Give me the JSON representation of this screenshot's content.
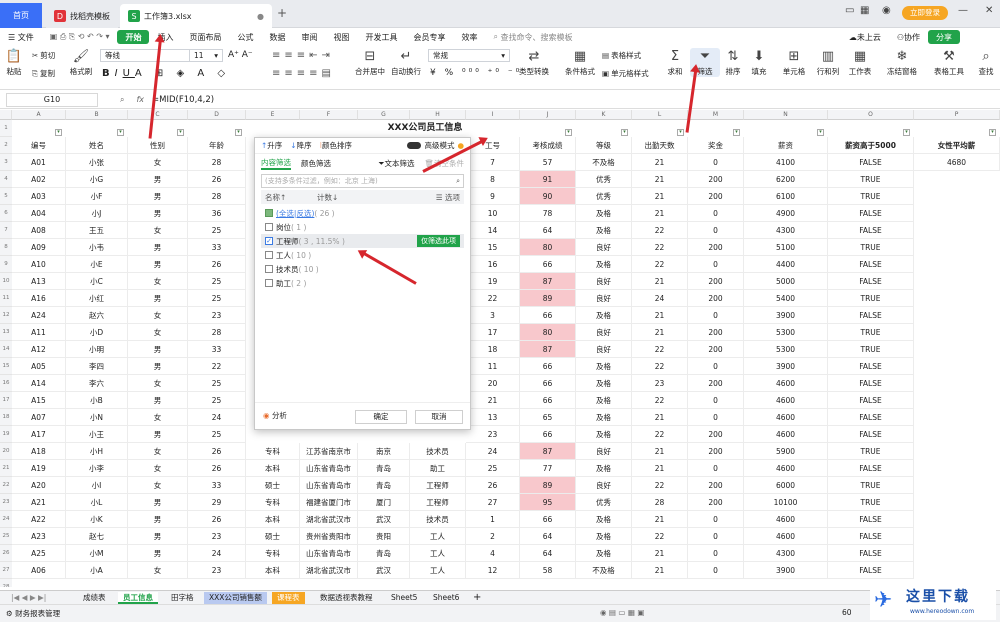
{
  "titlebar": {
    "home": "首页",
    "tab1": "找稻壳模板",
    "tab2": "工作簿3.xlsx",
    "login": "立即登录",
    "min": "—",
    "close": "✕"
  },
  "menu": {
    "file": "文件",
    "items": [
      "开始",
      "插入",
      "页面布局",
      "公式",
      "数据",
      "审阅",
      "视图",
      "开发工具",
      "会员专享",
      "效率"
    ],
    "search": "查找命令、搜索模板",
    "cloud": "未上云",
    "collab": "协作",
    "share": "分享"
  },
  "ribbon": {
    "paste": "粘贴",
    "cut": "剪切",
    "copy": "复制",
    "fmt": "格式刷",
    "font": "等线",
    "size": "11",
    "merge": "合并居中",
    "wrap": "自动换行",
    "numfmt": "常规",
    "convert": "类型转换",
    "cond": "条件格式",
    "tblstyle": "表格样式",
    "cellstyle": "单元格样式",
    "sum": "求和",
    "filter": "筛选",
    "sort": "排序",
    "fill": "填充",
    "cellg": "单元格",
    "rowcol": "行和列",
    "sheet": "工作表",
    "freeze": "冻结窗格",
    "tools": "表格工具",
    "find": "查找"
  },
  "formula": {
    "cellref": "G10",
    "fx": "fx",
    "content": "=MID(F10,4,2)"
  },
  "columns": [
    "A",
    "B",
    "C",
    "D",
    "E",
    "F",
    "G",
    "H",
    "I",
    "J",
    "K",
    "L",
    "M",
    "N",
    "O",
    "P"
  ],
  "sheet_title": "XXX公司员工信息",
  "headers": [
    "编号",
    "姓名",
    "性别",
    "年龄",
    "",
    "",
    "",
    "",
    "工号",
    "考核成绩",
    "等级",
    "出勤天数",
    "奖金",
    "薪资",
    "薪资高于5000",
    "女性平均薪"
  ],
  "avg_value": "4680",
  "rows": [
    [
      "A01",
      "小张",
      "女",
      "28",
      "",
      "",
      "",
      "",
      "7",
      "57",
      "不及格",
      "21",
      "0",
      "4100",
      "FALSE"
    ],
    [
      "A02",
      "小G",
      "男",
      "26",
      "",
      "",
      "",
      "",
      "8",
      "91",
      "优秀",
      "21",
      "200",
      "6200",
      "TRUE"
    ],
    [
      "A03",
      "小F",
      "男",
      "28",
      "",
      "",
      "",
      "",
      "9",
      "90",
      "优秀",
      "21",
      "200",
      "6100",
      "TRUE"
    ],
    [
      "A04",
      "小J",
      "男",
      "36",
      "",
      "",
      "",
      "",
      "10",
      "78",
      "及格",
      "21",
      "0",
      "4900",
      "FALSE"
    ],
    [
      "A08",
      "王五",
      "女",
      "25",
      "",
      "",
      "",
      "",
      "14",
      "64",
      "及格",
      "22",
      "0",
      "4300",
      "FALSE"
    ],
    [
      "A09",
      "小韦",
      "男",
      "33",
      "",
      "",
      "",
      "",
      "15",
      "80",
      "良好",
      "22",
      "200",
      "5100",
      "TRUE"
    ],
    [
      "A10",
      "小E",
      "男",
      "26",
      "",
      "",
      "",
      "",
      "16",
      "66",
      "及格",
      "22",
      "0",
      "4400",
      "FALSE"
    ],
    [
      "A13",
      "小C",
      "女",
      "25",
      "",
      "",
      "",
      "",
      "19",
      "87",
      "良好",
      "21",
      "200",
      "5000",
      "FALSE"
    ],
    [
      "A16",
      "小红",
      "男",
      "25",
      "",
      "",
      "",
      "",
      "22",
      "89",
      "良好",
      "24",
      "200",
      "5400",
      "TRUE"
    ],
    [
      "A24",
      "赵六",
      "女",
      "23",
      "",
      "",
      "",
      "",
      "3",
      "66",
      "及格",
      "21",
      "0",
      "3900",
      "FALSE"
    ],
    [
      "A11",
      "小D",
      "女",
      "28",
      "",
      "",
      "",
      "",
      "17",
      "80",
      "良好",
      "21",
      "200",
      "5300",
      "TRUE"
    ],
    [
      "A12",
      "小明",
      "男",
      "33",
      "",
      "",
      "",
      "",
      "18",
      "87",
      "良好",
      "22",
      "200",
      "5300",
      "TRUE"
    ],
    [
      "A05",
      "李四",
      "男",
      "22",
      "",
      "",
      "",
      "",
      "11",
      "66",
      "及格",
      "22",
      "0",
      "3900",
      "FALSE"
    ],
    [
      "A14",
      "李六",
      "女",
      "25",
      "",
      "",
      "",
      "",
      "20",
      "66",
      "及格",
      "23",
      "200",
      "4600",
      "FALSE"
    ],
    [
      "A15",
      "小B",
      "男",
      "25",
      "",
      "",
      "",
      "",
      "21",
      "66",
      "及格",
      "22",
      "0",
      "4600",
      "FALSE"
    ],
    [
      "A07",
      "小N",
      "女",
      "24",
      "",
      "",
      "",
      "",
      "13",
      "65",
      "及格",
      "21",
      "0",
      "4600",
      "FALSE"
    ],
    [
      "A17",
      "小王",
      "男",
      "25",
      "",
      "",
      "",
      "",
      "23",
      "66",
      "及格",
      "22",
      "200",
      "4600",
      "FALSE"
    ],
    [
      "A18",
      "小H",
      "女",
      "26",
      "专科",
      "江苏省南京市",
      "南京",
      "技术员",
      "24",
      "87",
      "良好",
      "21",
      "200",
      "5900",
      "TRUE"
    ],
    [
      "A19",
      "小李",
      "女",
      "26",
      "本科",
      "山东省青岛市",
      "青岛",
      "助工",
      "25",
      "77",
      "及格",
      "21",
      "0",
      "4600",
      "FALSE"
    ],
    [
      "A20",
      "小I",
      "女",
      "33",
      "硕士",
      "山东省青岛市",
      "青岛",
      "工程师",
      "26",
      "89",
      "良好",
      "22",
      "200",
      "6000",
      "TRUE"
    ],
    [
      "A21",
      "小L",
      "男",
      "29",
      "专科",
      "福建省厦门市",
      "厦门",
      "工程师",
      "27",
      "95",
      "优秀",
      "28",
      "200",
      "10100",
      "TRUE"
    ],
    [
      "A22",
      "小K",
      "男",
      "26",
      "本科",
      "湖北省武汉市",
      "武汉",
      "技术员",
      "1",
      "66",
      "及格",
      "21",
      "0",
      "4600",
      "FALSE"
    ],
    [
      "A23",
      "赵七",
      "男",
      "23",
      "硕士",
      "贵州省贵阳市",
      "贵阳",
      "工人",
      "2",
      "64",
      "及格",
      "22",
      "0",
      "4600",
      "FALSE"
    ],
    [
      "A25",
      "小M",
      "男",
      "24",
      "专科",
      "山东省青岛市",
      "青岛",
      "工人",
      "4",
      "64",
      "及格",
      "21",
      "0",
      "4300",
      "FALSE"
    ],
    [
      "A06",
      "小A",
      "女",
      "23",
      "本科",
      "湖北省武汉市",
      "武汉",
      "工人",
      "12",
      "58",
      "不及格",
      "21",
      "0",
      "3900",
      "FALSE"
    ]
  ],
  "popup": {
    "asc": "升序",
    "desc": "降序",
    "color_sort": "颜色排序",
    "adv": "高级模式",
    "tab_content": "内容筛选",
    "tab_color": "颜色筛选",
    "text_filter": "文本筛选",
    "clear": "清空条件",
    "search_ph": "(支持多条件过滤，例如：北京 上海)",
    "col_name": "名称↑",
    "col_count": "计数↓",
    "options": "选项",
    "items": [
      {
        "label": "(全选|反选)",
        "count": "( 26 )",
        "state": "part"
      },
      {
        "label": "岗位",
        "count": "( 1 )",
        "state": "off"
      },
      {
        "label": "工程师",
        "count": "( 3 , 11.5% )",
        "state": "on"
      },
      {
        "label": "工人",
        "count": "( 10 )",
        "state": "off"
      },
      {
        "label": "技术员",
        "count": "( 10 )",
        "state": "off"
      },
      {
        "label": "助工",
        "count": "( 2 )",
        "state": "off"
      }
    ],
    "only_this": "仅筛选此项",
    "analysis": "分析",
    "ok": "确定",
    "cancel": "取消"
  },
  "sheets": [
    "成绩表",
    "员工信息",
    "田字格",
    "XXX公司销售额",
    "课程表",
    "数据透视表教程",
    "Sheet5",
    "Sheet6"
  ],
  "status": {
    "left": "财务报表管理",
    "zoom": "60"
  },
  "watermark": "这里下载",
  "watermark_url": "www.hereodown.com",
  "colors": {
    "accent": "#21a34a",
    "pink": "#f8c8cc",
    "arrow": "#d6262d"
  }
}
